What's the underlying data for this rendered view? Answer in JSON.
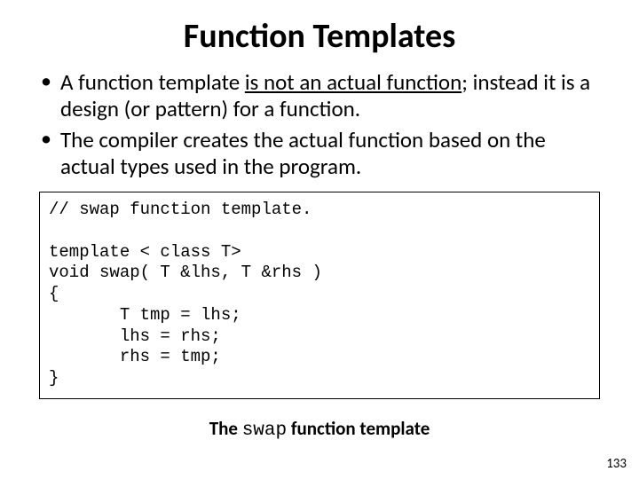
{
  "title": "Function Templates",
  "bullets": [
    {
      "pre": "A function template ",
      "u": "is not an actual function",
      "post": "; instead it is a design (or pattern) for a function."
    },
    {
      "pre": "The compiler creates the actual function based on the actual types used in the program.",
      "u": "",
      "post": ""
    }
  ],
  "code": "// swap function template.\n\ntemplate < class T>\nvoid swap( T &lhs, T &rhs )\n{\n       T tmp = lhs;\n       lhs = rhs;\n       rhs = tmp;\n}",
  "caption_pre": "The ",
  "caption_mono": "swap",
  "caption_post": " function template",
  "page_number": "133"
}
